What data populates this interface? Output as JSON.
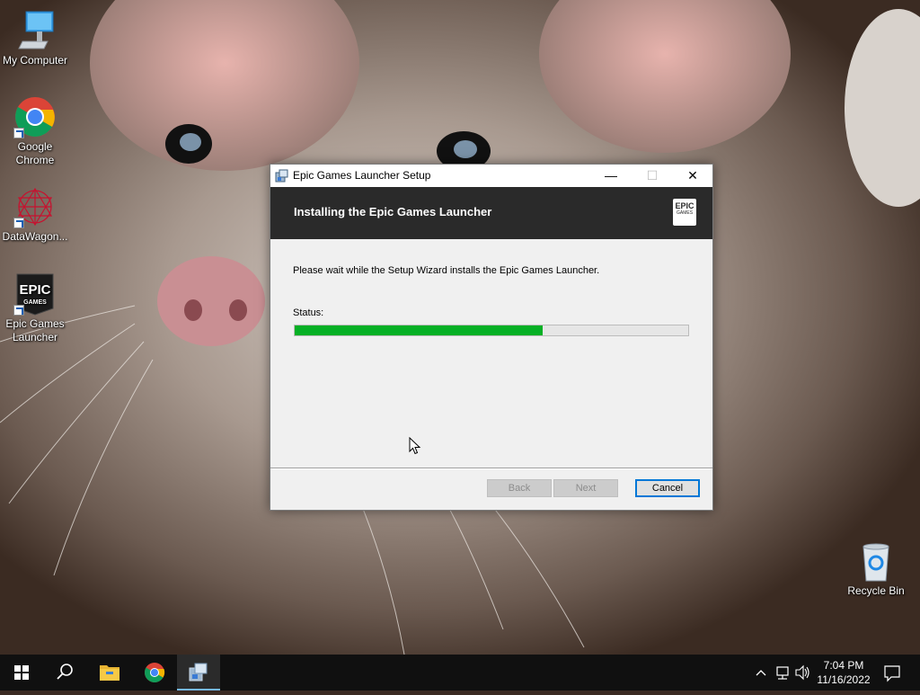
{
  "desktop": {
    "icons": [
      {
        "label": "My Computer",
        "icon": "computer-icon"
      },
      {
        "label": "Google Chrome",
        "icon": "chrome-icon"
      },
      {
        "label": "DataWagon...",
        "icon": "datawagon-icon"
      },
      {
        "label": "Epic Games Launcher",
        "icon": "epic-games-icon"
      },
      {
        "label": "Recycle Bin",
        "icon": "recycle-bin-icon"
      }
    ]
  },
  "dialog": {
    "title": "Epic Games Launcher Setup",
    "heading": "Installing the Epic Games Launcher",
    "logo_line1": "EPIC",
    "logo_line2": "GAMES",
    "wait_text": "Please wait while the Setup Wizard installs the Epic Games Launcher.",
    "status_label": "Status:",
    "progress": 0.63,
    "buttons": {
      "back": "Back",
      "next": "Next",
      "cancel": "Cancel"
    },
    "window_controls": {
      "minimize": "—",
      "maximize": "☐",
      "close": "✕"
    }
  },
  "taskbar": {
    "items": [
      "start-icon",
      "search-icon",
      "file-explorer-icon",
      "chrome-icon",
      "installer-icon"
    ],
    "active": "installer-icon",
    "clock": {
      "time": "7:04 PM",
      "date": "11/16/2022"
    }
  },
  "colors": {
    "progress": "#06b025",
    "accent": "#0078d7",
    "banner": "#2a2a2a"
  }
}
